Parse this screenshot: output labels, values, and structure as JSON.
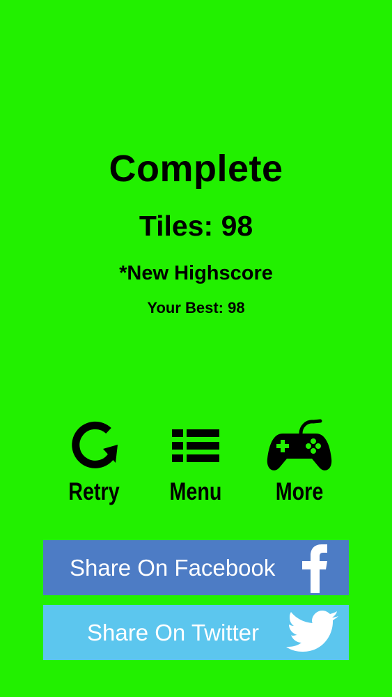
{
  "colors": {
    "background": "#22f000",
    "facebook": "#4d7cc5",
    "twitter": "#5cc6ee",
    "text": "#000000"
  },
  "result": {
    "title": "Complete",
    "tiles": "Tiles: 98",
    "highscore": "*New Highscore",
    "best": "Your Best: 98"
  },
  "actions": {
    "retry": {
      "label": "Retry",
      "icon": "retry-icon"
    },
    "menu": {
      "label": "Menu",
      "icon": "list-icon"
    },
    "more": {
      "label": "More",
      "icon": "gamepad-icon"
    }
  },
  "share": {
    "facebook": {
      "label": "Share On Facebook",
      "icon": "facebook-icon"
    },
    "twitter": {
      "label": "Share On Twitter",
      "icon": "twitter-bird-icon"
    }
  }
}
